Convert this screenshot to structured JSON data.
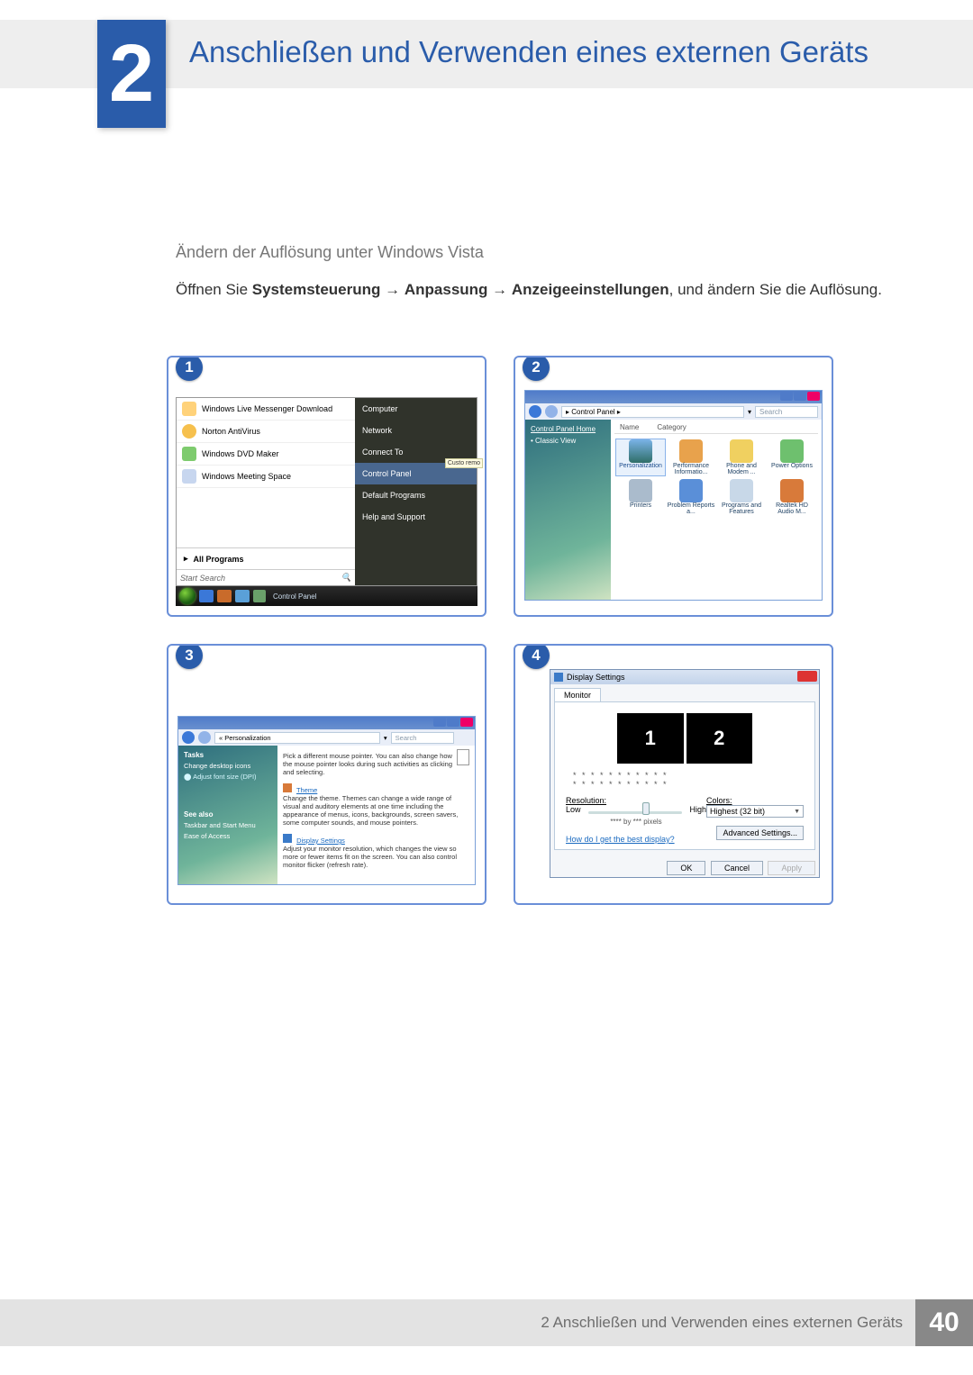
{
  "chapter": {
    "number": "2",
    "title": "Anschließen und Verwenden eines externen Geräts"
  },
  "section": {
    "title": "Ändern der Auflösung unter Windows Vista"
  },
  "instruction": {
    "pre": "Öffnen Sie ",
    "path1": "Systemsteuerung",
    "arrow": " → ",
    "path2": "Anpassung",
    "path3": "Anzeigeeinstellungen",
    "post": ", und ändern Sie die Auflösung."
  },
  "steps": {
    "s1": "1",
    "s2": "2",
    "s3": "3",
    "s4": "4"
  },
  "panel1": {
    "menu_left": [
      "Windows Live Messenger Download",
      "Norton AntiVirus",
      "Windows DVD Maker",
      "Windows Meeting Space"
    ],
    "all_programs": "All Programs",
    "search_placeholder": "Start Search",
    "menu_right": [
      "Computer",
      "Network",
      "Connect To",
      "Control Panel",
      "Default Programs",
      "Help and Support"
    ],
    "task_label": "Control Panel",
    "tooltip": "Custo remo"
  },
  "panel2": {
    "path": "▸ Control Panel ▸",
    "search": "Search",
    "side_home": "Control Panel Home",
    "side_classic": "Classic View",
    "col_name": "Name",
    "col_cat": "Category",
    "icons": [
      "Personalization",
      "Performance Informatio...",
      "Phone and Modem ...",
      "Power Options",
      "Printers",
      "Problem Reports a...",
      "Programs and Features",
      "Realtek HD Audio M..."
    ]
  },
  "panel3": {
    "path": "« Personalization",
    "search": "Search",
    "tasks_h": "Tasks",
    "tasks": [
      "Change desktop icons",
      "Adjust font size (DPI)"
    ],
    "seealso_h": "See also",
    "seealso": [
      "Taskbar and Start Menu",
      "Ease of Access"
    ],
    "block1_t": "",
    "block1_d": "Pick a different mouse pointer. You can also change how the mouse pointer looks during such activities as clicking and selecting.",
    "block2_t": "Theme",
    "block2_d": "Change the theme. Themes can change a wide range of visual and auditory elements at one time including the appearance of menus, icons, backgrounds, screen savers, some computer sounds, and mouse pointers.",
    "block3_t": "Display Settings",
    "block3_d": "Adjust your monitor resolution, which changes the view so more or fewer items fit on the screen. You can also control monitor flicker (refresh rate)."
  },
  "panel4": {
    "title": "Display Settings",
    "tab": "Monitor",
    "mon1": "1",
    "mon2": "2",
    "dots": "* * * * * * * * * * *",
    "res_label": "Resolution:",
    "low": "Low",
    "high": "High",
    "res_value": "**** by *** pixels",
    "colors_label": "Colors:",
    "colors_value": "Highest (32 bit)",
    "help": "How do I get the best display?",
    "adv": "Advanced Settings...",
    "ok": "OK",
    "cancel": "Cancel",
    "apply": "Apply"
  },
  "footer": {
    "text": "2 Anschließen und Verwenden eines externen Geräts",
    "page": "40"
  }
}
